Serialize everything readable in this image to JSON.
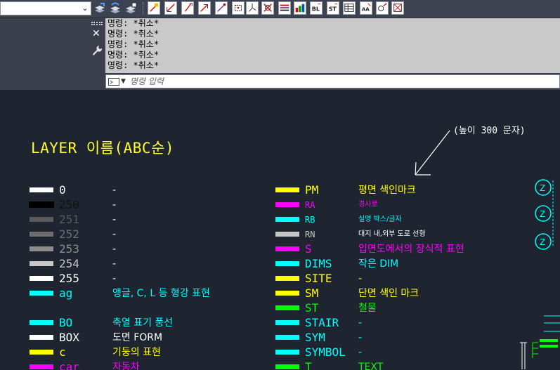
{
  "toolbar": {
    "layer_combo_value": "",
    "icons": [
      "layer-state-icon",
      "layer-previous-icon",
      "layer-isolate-icon",
      "tool-1-icon",
      "tool-2-icon",
      "tool-3-icon",
      "tool-4-icon",
      "tool-5-icon",
      "tool-6-icon",
      "tool-7-icon",
      "tool-8-icon",
      "tool-9-icon",
      "tool-10-icon",
      "tool-11-icon",
      "tool-12-icon",
      "tool-13-icon",
      "tool-14-icon",
      "tool-15-icon",
      "tool-16-icon"
    ]
  },
  "command_line": {
    "history": [
      "명령: *취소*",
      "명령: *취소*",
      "명령: *취소*",
      "명령: *취소*",
      "명령: *취소*"
    ],
    "input_placeholder": "명령 입력"
  },
  "drawing": {
    "title": "LAYER 이름(ABC순)",
    "annotation": "(높이 300 문자)",
    "left_layers": [
      {
        "name": "0",
        "description": "-",
        "color": "#ffffff"
      },
      {
        "name": "250",
        "description": "-",
        "color": "#000000"
      },
      {
        "name": "251",
        "description": "-",
        "color": "#5a5a5a"
      },
      {
        "name": "252",
        "description": "-",
        "color": "#6e6e6e"
      },
      {
        "name": "253",
        "description": "-",
        "color": "#8c8c8c"
      },
      {
        "name": "254",
        "description": "-",
        "color": "#c8c8c8"
      },
      {
        "name": "255",
        "description": "-",
        "color": "#ffffff"
      },
      {
        "name": "ag",
        "description": "앵글, C, L 등 형강 표현",
        "color": "#00ffff"
      },
      {
        "name": "BO",
        "description": "축열 표기 풍선",
        "color": "#00ffff"
      },
      {
        "name": "BOX",
        "description": "도면 FORM",
        "color": "#ffffff"
      },
      {
        "name": "c",
        "description": "기둥의 표현",
        "color": "#ffff00"
      },
      {
        "name": "car",
        "description": "자동차",
        "color": "#ff00ff"
      }
    ],
    "right_layers": [
      {
        "name": "PM",
        "description": "평면 색인마크",
        "color": "#ffff00",
        "size": "normal"
      },
      {
        "name": "RA",
        "description": "경사로",
        "color": "#ff00ff",
        "size": "small"
      },
      {
        "name": "RB",
        "description": "실명 박스/글자",
        "color": "#00ffff",
        "size": "small"
      },
      {
        "name": "RN",
        "description": "대지 내,외부 도로 선형",
        "color": "#c8c8c8",
        "size": "small"
      },
      {
        "name": "S",
        "description": "입면도에서의 장식적 표현",
        "color": "#ff00ff",
        "size": "normal"
      },
      {
        "name": "DIMS",
        "description": "작은 DIM",
        "color": "#00ffff",
        "size": "normal"
      },
      {
        "name": "SITE",
        "description": "-",
        "color": "#ffff00",
        "size": "normal"
      },
      {
        "name": "SM",
        "description": "단면 색인 마크",
        "color": "#ffff00",
        "size": "normal"
      },
      {
        "name": "ST",
        "description": "철물",
        "color": "#00ff00",
        "size": "normal"
      },
      {
        "name": "STAIR",
        "description": "-",
        "color": "#00ffff",
        "size": "normal"
      },
      {
        "name": "SYM",
        "description": "-",
        "color": "#00ffff",
        "size": "normal"
      },
      {
        "name": "SYMBOL",
        "description": "-",
        "color": "#00ffff",
        "size": "normal"
      },
      {
        "name": "T",
        "description": "TEXT",
        "color": "#00ff00",
        "size": "normal"
      }
    ],
    "axis_bubbles": [
      "Z",
      "Z",
      "Z"
    ],
    "colors": {
      "background": "#1e2430",
      "title": "#ffff33",
      "annotation": "#ffffff"
    }
  }
}
